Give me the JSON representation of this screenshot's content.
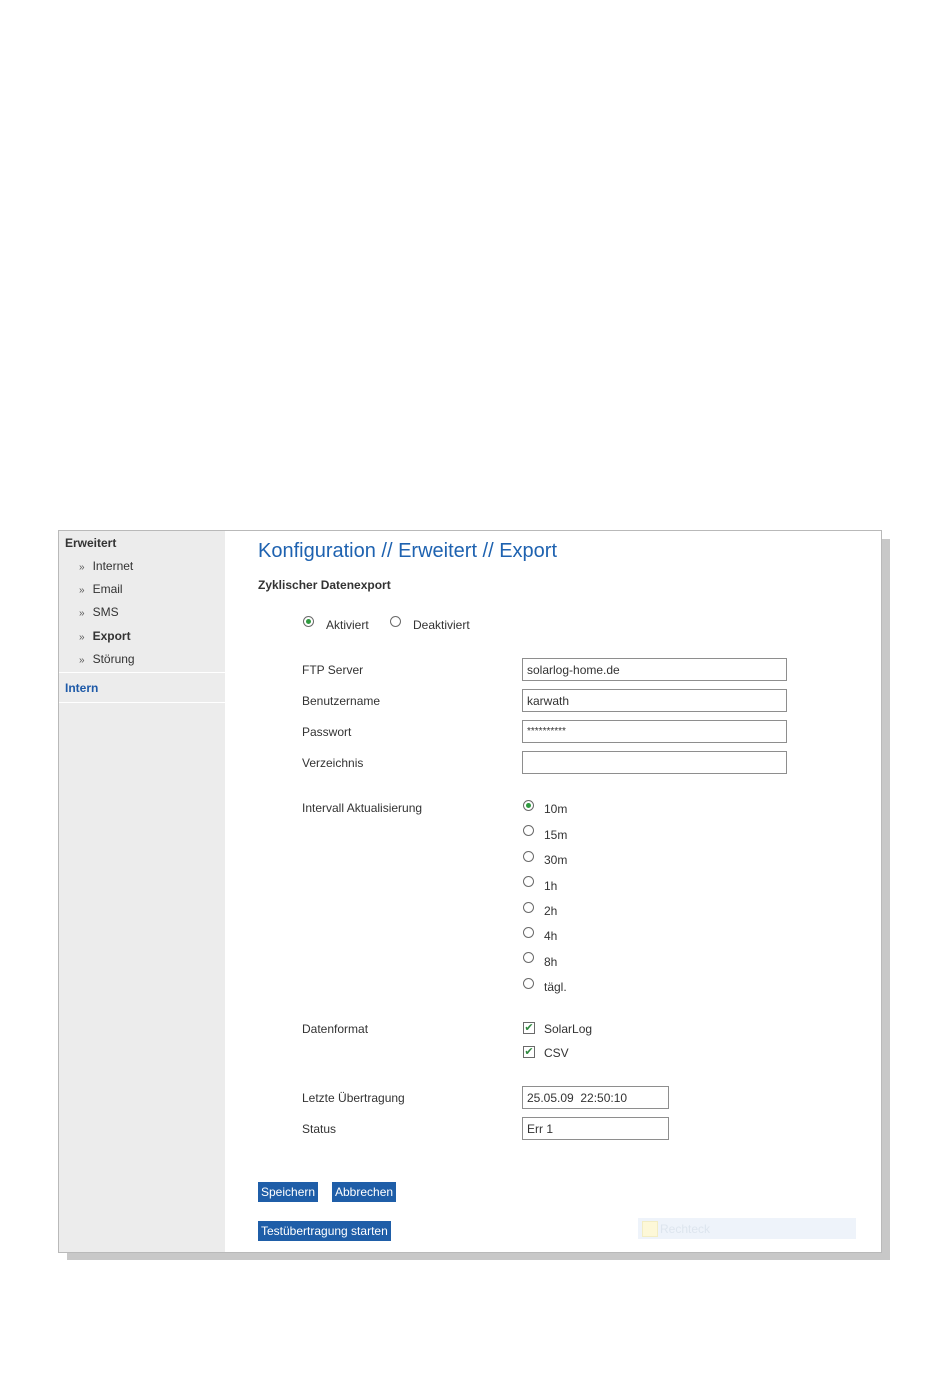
{
  "sidebar": {
    "heading": "Erweitert",
    "bullet": "»",
    "items": [
      {
        "label": "Internet",
        "active": false
      },
      {
        "label": "Email",
        "active": false
      },
      {
        "label": "SMS",
        "active": false
      },
      {
        "label": "Export",
        "active": true
      },
      {
        "label": "Störung",
        "active": false
      }
    ],
    "intern": "Intern"
  },
  "page": {
    "title": "Konfiguration // Erweitert // Export",
    "section": "Zyklischer Datenexport"
  },
  "activation": {
    "options": [
      {
        "label": "Aktiviert",
        "checked": true
      },
      {
        "label": "Deaktiviert",
        "checked": false
      }
    ]
  },
  "form": {
    "ftp_label": "FTP Server",
    "ftp_value": "solarlog-home.de",
    "user_label": "Benutzername",
    "user_value": "karwath",
    "pass_label": "Passwort",
    "pass_value": "**********",
    "dir_label": "Verzeichnis",
    "dir_value": "",
    "interval_label": "Intervall Aktualisierung",
    "intervals": [
      {
        "label": "10m",
        "checked": true
      },
      {
        "label": "15m",
        "checked": false
      },
      {
        "label": "30m",
        "checked": false
      },
      {
        "label": "1h",
        "checked": false
      },
      {
        "label": "2h",
        "checked": false
      },
      {
        "label": "4h",
        "checked": false
      },
      {
        "label": "8h",
        "checked": false
      },
      {
        "label": "tägl.",
        "checked": false
      }
    ],
    "format_label": "Datenformat",
    "formats": [
      {
        "label": "SolarLog",
        "checked": true
      },
      {
        "label": "CSV",
        "checked": true
      }
    ],
    "last_label": "Letzte Übertragung",
    "last_value": "25.05.09  22:50:10",
    "status_label": "Status",
    "status_value": "Err 1"
  },
  "buttons": {
    "save": "Speichern",
    "cancel": "Abbrechen",
    "test": "Testübertragung starten"
  },
  "ghost": {
    "label": "Rechteck"
  },
  "colors": {
    "accent": "#1f5ea8",
    "title": "#1e62b0",
    "check": "#2f9a3f"
  }
}
